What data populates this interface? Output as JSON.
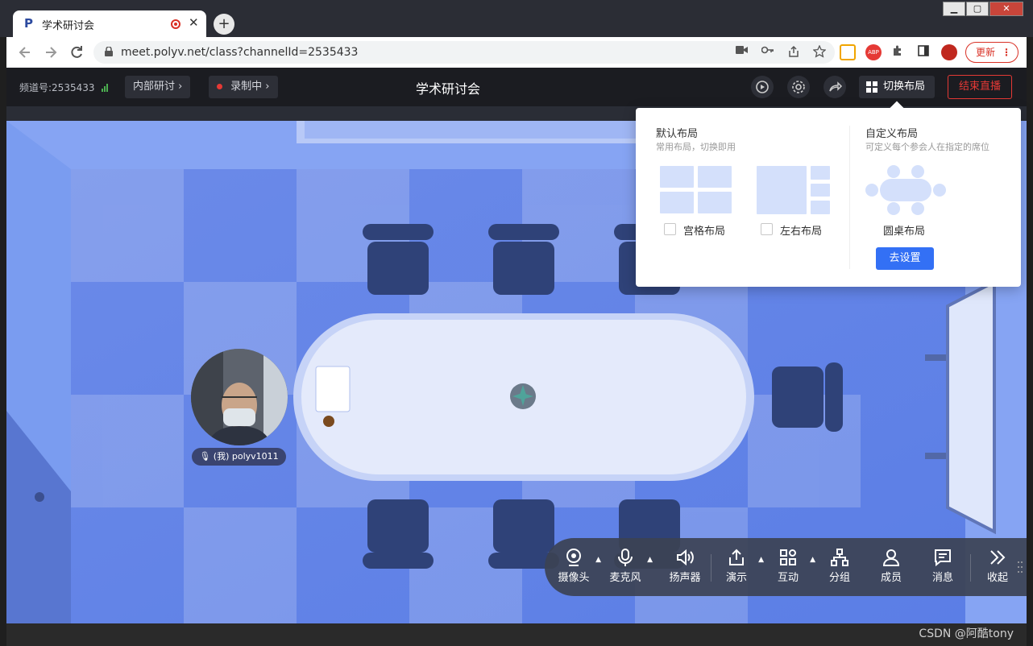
{
  "browser": {
    "tab_title": "学术研讨会",
    "new_tab": "+",
    "close_tab": "✕",
    "url": "meet.polyv.net/class?channelId=2535433",
    "update_label": "更新",
    "window_controls": [
      "▁",
      "▢",
      "✕"
    ]
  },
  "app": {
    "channel_label": "频道号:2535433",
    "chip_internal": "内部研讨",
    "chip_recording": "录制中",
    "title": "学术研讨会",
    "layout_button": "切换布局",
    "end_button": "结束直播",
    "accent": "#3370f5",
    "danger": "#e53935"
  },
  "layout_popup": {
    "default_title": "默认布局",
    "default_sub": "常用布局，切换即用",
    "custom_title": "自定义布局",
    "custom_sub": "可定义每个参会人在指定的席位",
    "grid_label": "宫格布局",
    "lr_label": "左右布局",
    "round_label": "圆桌布局",
    "go_button": "去设置"
  },
  "participant": {
    "name": "(我) polyv1011"
  },
  "controls": [
    {
      "label": "摄像头",
      "icon": "camera-icon",
      "caret": true
    },
    {
      "label": "麦克风",
      "icon": "mic-icon",
      "caret": true
    },
    {
      "label": "扬声器",
      "icon": "speaker-icon",
      "caret": false
    },
    {
      "label": "演示",
      "icon": "share-icon",
      "caret": true
    },
    {
      "label": "互动",
      "icon": "apps-icon",
      "caret": true
    },
    {
      "label": "分组",
      "icon": "group-icon",
      "caret": false
    },
    {
      "label": "成员",
      "icon": "member-icon",
      "caret": false
    },
    {
      "label": "消息",
      "icon": "message-icon",
      "caret": false
    },
    {
      "label": "收起",
      "icon": "collapse-icon",
      "caret": false
    }
  ],
  "watermark": "CSDN @阿酷tony"
}
